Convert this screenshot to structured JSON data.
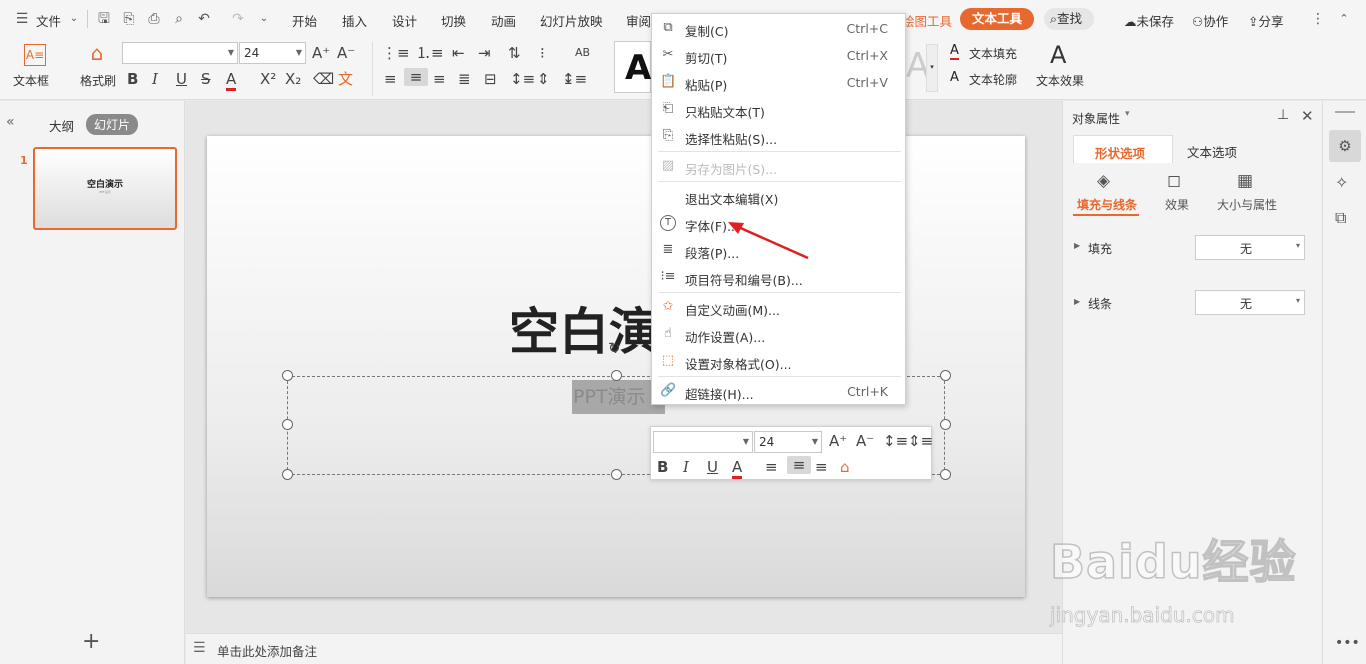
{
  "menubar": {
    "file_menu": "文件",
    "tabs": [
      "开始",
      "插入",
      "设计",
      "切换",
      "动画",
      "幻灯片放映",
      "审阅"
    ],
    "drawing_tools_tab": "绘图工具",
    "text_tools_tab": "文本工具",
    "search_label": "查找",
    "unsaved_label": "未保存",
    "collab_label": "协作",
    "share_label": "分享"
  },
  "ribbon": {
    "textbox_label": "文本框",
    "format_painter_label": "格式刷",
    "font_name": "",
    "font_size": "24",
    "text_fill_label": "文本填充",
    "text_outline_label": "文本轮廓",
    "text_effect_label": "文本效果",
    "style_preview_glyph": "A"
  },
  "left_panel": {
    "outline_tab": "大纲",
    "slides_tab": "幻灯片",
    "slide_number": "1",
    "thumb_title": "空白演示",
    "thumb_sub": "PPT演示"
  },
  "slide": {
    "title_visible": "空白演",
    "subtitle_visible": "PPT演示"
  },
  "notes_placeholder": "单击此处添加备注",
  "context_menu": {
    "items": [
      {
        "label": "复制(C)",
        "shortcut": "Ctrl+C",
        "icon": "copy-icon"
      },
      {
        "label": "剪切(T)",
        "shortcut": "Ctrl+X",
        "icon": "scissors-icon"
      },
      {
        "label": "粘贴(P)",
        "shortcut": "Ctrl+V",
        "icon": "paste-icon"
      },
      {
        "label": "只粘贴文本(T)",
        "shortcut": "",
        "icon": "paste-text-icon"
      },
      {
        "label": "选择性粘贴(S)...",
        "shortcut": "",
        "icon": "paste-special-icon"
      },
      {
        "label": "另存为图片(S)...",
        "shortcut": "",
        "icon": "save-image-icon",
        "disabled": true
      },
      {
        "label": "退出文本编辑(X)",
        "shortcut": "",
        "icon": ""
      },
      {
        "label": "字体(F)...",
        "shortcut": "",
        "icon": "font-icon"
      },
      {
        "label": "段落(P)...",
        "shortcut": "",
        "icon": "paragraph-icon"
      },
      {
        "label": "项目符号和编号(B)...",
        "shortcut": "",
        "icon": "bullets-icon"
      },
      {
        "label": "自定义动画(M)...",
        "shortcut": "",
        "icon": "animation-icon"
      },
      {
        "label": "动作设置(A)...",
        "shortcut": "",
        "icon": "action-icon"
      },
      {
        "label": "设置对象格式(O)...",
        "shortcut": "",
        "icon": "format-object-icon"
      },
      {
        "label": "超链接(H)...",
        "shortcut": "Ctrl+K",
        "icon": "link-icon"
      }
    ]
  },
  "mini_toolbar": {
    "font_name": "",
    "font_size": "24"
  },
  "right_panel": {
    "title": "对象属性",
    "tab_shape": "形状选项",
    "tab_text": "文本选项",
    "sub_fill_line": "填充与线条",
    "sub_effect": "效果",
    "sub_size": "大小与属性",
    "fill_label": "填充",
    "fill_value": "无",
    "line_label": "线条",
    "line_value": "无"
  },
  "watermark": {
    "brand": "Baidu经验",
    "url": "jingyan.baidu.com"
  },
  "colors": {
    "accent": "#e8692f",
    "arrow": "#e02020"
  }
}
